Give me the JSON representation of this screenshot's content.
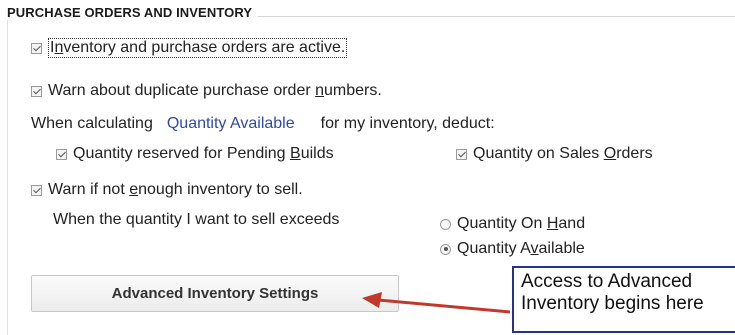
{
  "section": {
    "title": "PURCHASE ORDERS AND INVENTORY"
  },
  "options": {
    "inventory_active": {
      "label_prefix": "I",
      "label_underline": "n",
      "label_rest": "ventory and purchase orders are active.",
      "checked": true
    },
    "warn_duplicate_po": {
      "label_prefix": "Warn about duplicate purchase order ",
      "label_underline": "n",
      "label_rest": "umbers.",
      "checked": true
    },
    "calc_line": {
      "prefix": "When calculating",
      "link": "Quantity Available",
      "suffix": "for my inventory, deduct:"
    },
    "reserved_pending_builds": {
      "label_prefix": "Quantity reserved for Pending ",
      "label_underline": "B",
      "label_rest": "uilds",
      "checked": true
    },
    "qty_sales_orders": {
      "label_prefix": "Quantity on Sales ",
      "label_underline": "O",
      "label_rest": "rders",
      "checked": true
    },
    "warn_not_enough": {
      "label_prefix": "Warn if not ",
      "label_underline": "e",
      "label_rest": "nough inventory to sell.",
      "checked": true
    },
    "sell_exceeds_label": "When the quantity I want to sell exceeds",
    "radio_on_hand": {
      "label_prefix": "Quantity On ",
      "label_underline": "H",
      "label_rest": "and",
      "selected": false
    },
    "radio_available": {
      "label_prefix": "Quantity A",
      "label_underline": "v",
      "label_rest": "ailable",
      "selected": true
    }
  },
  "buttons": {
    "advanced_inventory": "Advanced Inventory Settings"
  },
  "callout": {
    "line1": "Access to Advanced",
    "line2": "Inventory begins here"
  },
  "colors": {
    "link": "#2e4aa8",
    "callout_border": "#23338a",
    "arrow": "#c0392b"
  }
}
